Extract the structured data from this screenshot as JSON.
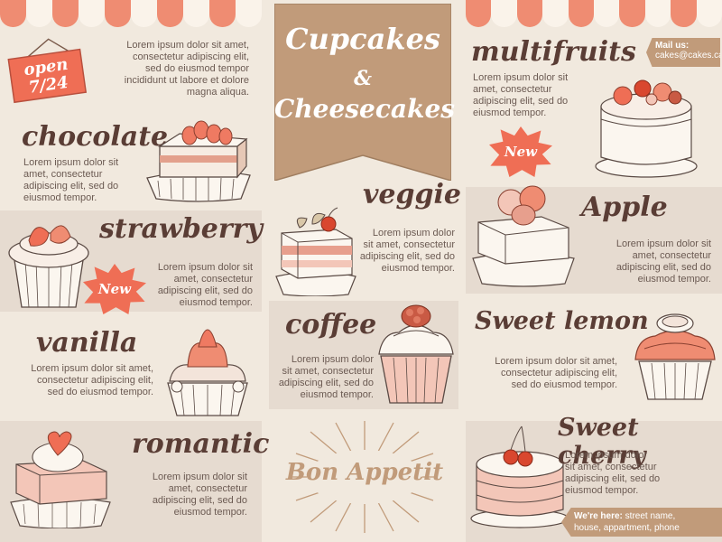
{
  "open_sign": {
    "line1": "open",
    "line2": "7/24"
  },
  "banner": {
    "title1": "Cupcakes",
    "amp": "&",
    "title2": "Cheesecakes"
  },
  "mail": {
    "label": "Mail us:",
    "value": "cakes@cakes.ca"
  },
  "address": {
    "label": "We're here:",
    "value1": "street name,",
    "value2": "house, appartment, phone"
  },
  "new_badge": "New",
  "bon_appetit": "Bon Appetit",
  "intro_text": [
    "Lorem ipsum dolor sit amet,",
    "consectetur adipiscing elit,",
    "sed do eiusmod tempor",
    "incididunt ut labore et dolore",
    "magna aliqua."
  ],
  "items": {
    "chocolate": {
      "title": "chocolate",
      "text": [
        "Lorem ipsum dolor sit",
        "amet,  consectetur",
        "adipiscing elit, sed do",
        "eiusmod tempor."
      ]
    },
    "strawberry": {
      "title": "strawberry",
      "text": [
        "Lorem ipsum dolor sit",
        "amet,  consectetur",
        "adipiscing elit, sed do",
        "eiusmod tempor."
      ]
    },
    "vanilla": {
      "title": "vanilla",
      "text": [
        "Lorem ipsum dolor sit amet,",
        "consectetur adipiscing elit,",
        "sed do eiusmod tempor."
      ]
    },
    "romantic": {
      "title": "romantic",
      "text": [
        "Lorem ipsum dolor sit",
        "amet,  consectetur",
        "adipiscing elit, sed do",
        "eiusmod tempor."
      ]
    },
    "veggie": {
      "title": "veggie",
      "text": [
        "Lorem ipsum dolor",
        "sit amet, consectetur",
        "adipiscing elit, sed do",
        "eiusmod tempor."
      ]
    },
    "coffee": {
      "title": "coffee",
      "text": [
        "Lorem ipsum dolor",
        "sit amet, consectetur",
        "adipiscing elit, sed do",
        "eiusmod tempor."
      ]
    },
    "multifruits": {
      "title": "multifruits",
      "text": [
        "Lorem ipsum dolor sit",
        "amet,  consectetur",
        "adipiscing elit, sed do",
        "eiusmod tempor."
      ]
    },
    "apple": {
      "title": "Apple",
      "text": [
        "Lorem ipsum dolor sit",
        "amet,  consectetur",
        "adipiscing elit, sed do",
        "eiusmod tempor."
      ]
    },
    "sweet_lemon": {
      "title": "Sweet lemon",
      "text": [
        "Lorem ipsum dolor sit amet,",
        "consectetur adipiscing elit,",
        "sed do eiusmod tempor."
      ]
    },
    "sweet_cherry": {
      "title": "Sweet cherry",
      "text": [
        "Lorem ipsum dolor",
        "sit amet, consectetur",
        "adipiscing elit, sed do",
        "eiusmod tempor."
      ]
    }
  },
  "colors": {
    "accent": "#ef6e55",
    "kraft": "#c19b7a",
    "band": "#e6dbd0",
    "background": "#f1e9de"
  }
}
